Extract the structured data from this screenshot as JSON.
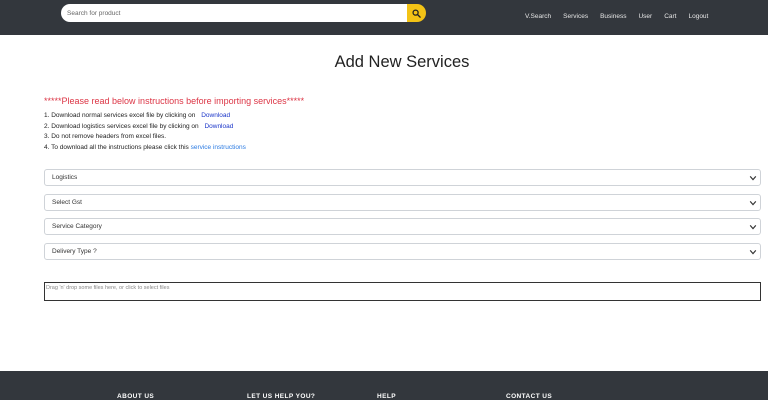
{
  "header": {
    "search_placeholder": "Search for product",
    "nav": [
      "V.Search",
      "Services",
      "Business",
      "User",
      "Cart",
      "Logout"
    ]
  },
  "main": {
    "title": "Add New Services",
    "warning": "*****Please read below instructions before importing services*****",
    "instructions": {
      "item1_text": "1. Download normal services excel file by clicking on",
      "item1_link": "Download",
      "item2_text": "2. Download logistics services excel file by clicking on",
      "item2_link": "Download",
      "item3_text": "3. Do not remove headers from excel files.",
      "item4_text": "4. To download all the instructions please click this",
      "item4_link": "service instructions"
    },
    "selects": {
      "type": "Logistics",
      "gst": "Select Gst",
      "category": "Service Category",
      "delivery": "Delivery Type ?"
    },
    "dropzone_text": "Drag 'n' drop some files here, or click to select files"
  },
  "footer": {
    "headings": [
      "ABOUT US",
      "LET US HELP YOU?",
      "HELP",
      "CONTACT US"
    ]
  },
  "colors": {
    "navbar": "#33373d",
    "search_button": "#f3c316",
    "warning": "#dc3545",
    "download_link": "#1a35c9",
    "instructions_link": "#2a7ae2"
  }
}
